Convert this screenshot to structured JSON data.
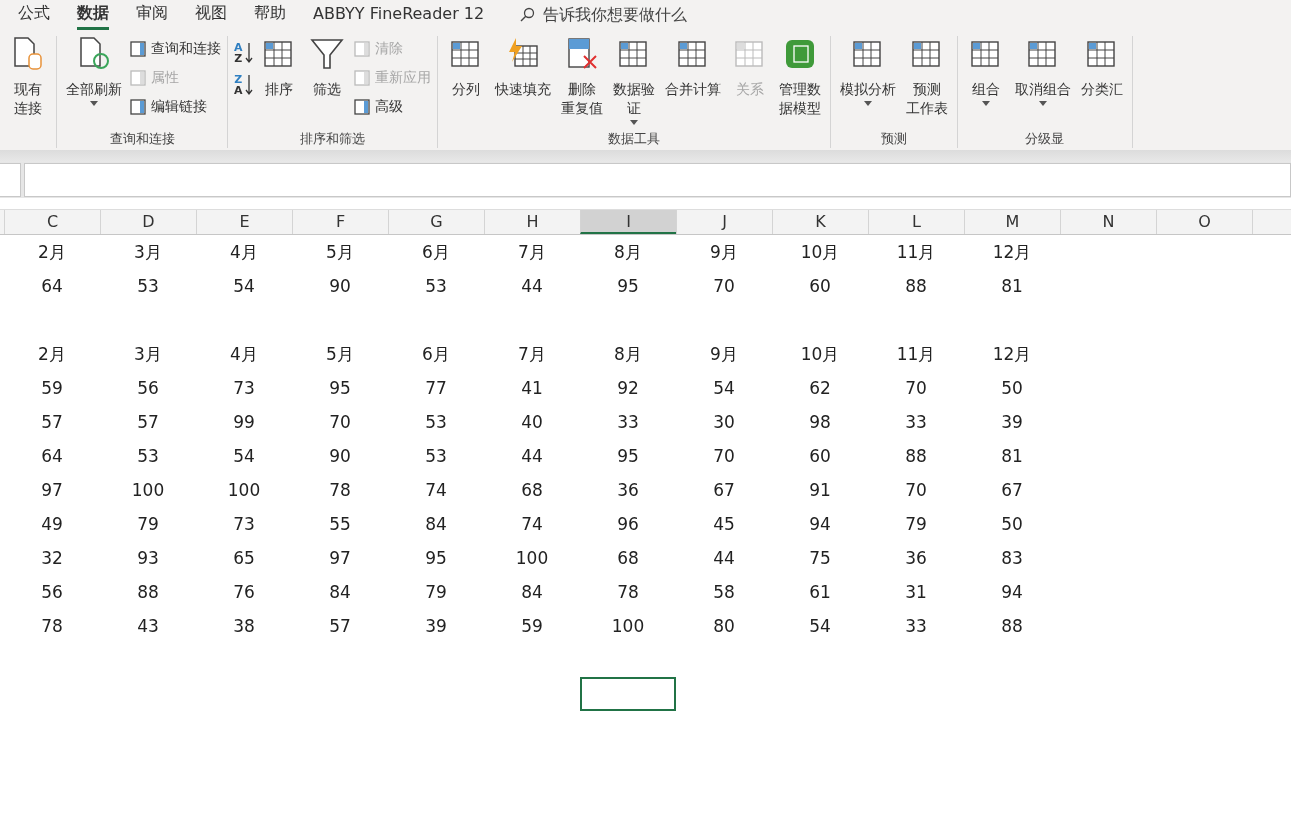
{
  "tabs": [
    {
      "label": "公式",
      "selected": false
    },
    {
      "label": "数据",
      "selected": true
    },
    {
      "label": "审阅",
      "selected": false
    },
    {
      "label": "视图",
      "selected": false
    },
    {
      "label": "帮助",
      "selected": false
    },
    {
      "label": "ABBYY FineReader 12",
      "selected": false
    }
  ],
  "tell_me": "告诉我你想要做什么",
  "groups": [
    {
      "items": [
        {
          "kind": "large",
          "lines": [
            "现有",
            "连接"
          ],
          "disabled": false,
          "dropdown": false
        }
      ]
    },
    {
      "label": "查询和连接",
      "items": [
        {
          "kind": "large",
          "lines": [
            "全部刷新"
          ],
          "disabled": false,
          "dropdown": true
        },
        {
          "kind": "stack",
          "entries": [
            {
              "label": "查询和连接",
              "disabled": false
            },
            {
              "label": "属性",
              "disabled": true
            },
            {
              "label": "编辑链接",
              "disabled": false
            }
          ]
        }
      ]
    },
    {
      "label": "排序和筛选",
      "items": [
        {
          "kind": "sort",
          "buttons": [
            {
              "letters": [
                "A",
                "Z"
              ]
            },
            {
              "letters": [
                "Z",
                "A"
              ]
            }
          ]
        },
        {
          "kind": "large",
          "lines": [
            "排序"
          ],
          "disabled": false,
          "dropdown": false
        },
        {
          "kind": "large",
          "lines": [
            "筛选"
          ],
          "disabled": false,
          "dropdown": false
        },
        {
          "kind": "stack",
          "entries": [
            {
              "label": "清除",
              "disabled": true
            },
            {
              "label": "重新应用",
              "disabled": true
            },
            {
              "label": "高级",
              "disabled": false
            }
          ]
        }
      ]
    },
    {
      "label": "数据工具",
      "items": [
        {
          "kind": "large",
          "lines": [
            "分列"
          ],
          "disabled": false,
          "dropdown": false
        },
        {
          "kind": "large",
          "lines": [
            "快速填充"
          ],
          "disabled": false,
          "dropdown": false
        },
        {
          "kind": "large",
          "lines": [
            "删除",
            "重复值"
          ],
          "disabled": false,
          "dropdown": false
        },
        {
          "kind": "large",
          "lines": [
            "数据验",
            "证"
          ],
          "disabled": false,
          "dropdown": true
        },
        {
          "kind": "large",
          "lines": [
            "合并计算"
          ],
          "disabled": false,
          "dropdown": false
        },
        {
          "kind": "large",
          "lines": [
            "关系"
          ],
          "disabled": true,
          "dropdown": false
        },
        {
          "kind": "large",
          "lines": [
            "管理数",
            "据模型"
          ],
          "disabled": false,
          "dropdown": false
        }
      ]
    },
    {
      "label": "预测",
      "items": [
        {
          "kind": "large",
          "lines": [
            "模拟分析"
          ],
          "disabled": false,
          "dropdown": true
        },
        {
          "kind": "large",
          "lines": [
            "预测",
            "工作表"
          ],
          "disabled": false,
          "dropdown": false
        }
      ]
    },
    {
      "label": "分级显",
      "items": [
        {
          "kind": "large",
          "lines": [
            "组合"
          ],
          "disabled": false,
          "dropdown": true
        },
        {
          "kind": "large",
          "lines": [
            "取消组合"
          ],
          "disabled": false,
          "dropdown": true
        },
        {
          "kind": "large",
          "lines": [
            "分类汇"
          ],
          "disabled": false,
          "dropdown": false
        }
      ]
    }
  ],
  "columns": [
    {
      "label": "C",
      "selected": false
    },
    {
      "label": "D",
      "selected": false
    },
    {
      "label": "E",
      "selected": false
    },
    {
      "label": "F",
      "selected": false
    },
    {
      "label": "G",
      "selected": false
    },
    {
      "label": "H",
      "selected": false
    },
    {
      "label": "I",
      "selected": true
    },
    {
      "label": "J",
      "selected": false
    },
    {
      "label": "K",
      "selected": false
    },
    {
      "label": "L",
      "selected": false
    },
    {
      "label": "M",
      "selected": false
    },
    {
      "label": "N",
      "selected": false
    },
    {
      "label": "O",
      "selected": false
    }
  ],
  "blocks": [
    {
      "header": [
        "2月",
        "3月",
        "4月",
        "5月",
        "6月",
        "7月",
        "8月",
        "9月",
        "10月",
        "11月",
        "12月"
      ],
      "rows": [
        [
          "64",
          "53",
          "54",
          "90",
          "53",
          "44",
          "95",
          "70",
          "60",
          "88",
          "81"
        ]
      ]
    },
    {
      "header": [
        "2月",
        "3月",
        "4月",
        "5月",
        "6月",
        "7月",
        "8月",
        "9月",
        "10月",
        "11月",
        "12月"
      ],
      "rows": [
        [
          "59",
          "56",
          "73",
          "95",
          "77",
          "41",
          "92",
          "54",
          "62",
          "70",
          "50"
        ],
        [
          "57",
          "57",
          "99",
          "70",
          "53",
          "40",
          "33",
          "30",
          "98",
          "33",
          "39"
        ],
        [
          "64",
          "53",
          "54",
          "90",
          "53",
          "44",
          "95",
          "70",
          "60",
          "88",
          "81"
        ],
        [
          "97",
          "100",
          "100",
          "78",
          "74",
          "68",
          "36",
          "67",
          "91",
          "70",
          "67"
        ],
        [
          "49",
          "79",
          "73",
          "55",
          "84",
          "74",
          "96",
          "45",
          "94",
          "79",
          "50"
        ],
        [
          "32",
          "93",
          "65",
          "97",
          "95",
          "100",
          "68",
          "44",
          "75",
          "36",
          "83"
        ],
        [
          "56",
          "88",
          "76",
          "84",
          "79",
          "84",
          "78",
          "58",
          "61",
          "31",
          "94"
        ],
        [
          "78",
          "43",
          "38",
          "57",
          "39",
          "59",
          "100",
          "80",
          "54",
          "33",
          "88"
        ]
      ]
    }
  ]
}
